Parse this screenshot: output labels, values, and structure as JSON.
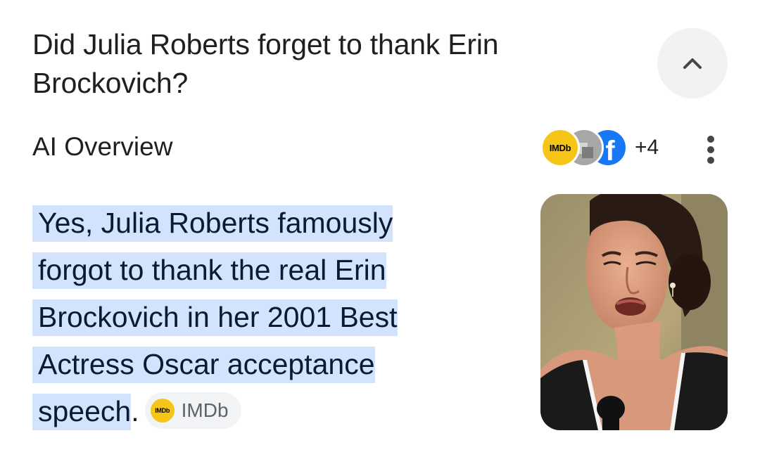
{
  "question": {
    "text": "Did Julia Roberts forget to thank Erin Brockovich?"
  },
  "collapse_icon": "chevron-up-icon",
  "overview": {
    "label": "AI Overview",
    "sources": {
      "avatars": [
        "imdb-logo",
        "grey-source-logo",
        "facebook-logo"
      ],
      "imdb_avatar_text": "IMDb",
      "facebook_avatar_text": "f",
      "more_count": "+4"
    },
    "menu_icon": "more-vert-icon"
  },
  "answer": {
    "text": "Yes, Julia Roberts famously forgot to thank the real Erin Brockovich in her 2001 Best Actress Oscar acceptance speech",
    "end_punct": ".",
    "source_chip": {
      "logo_text": "IMDb",
      "label": "IMDb"
    }
  },
  "image": {
    "subject": "photo of woman with dark hair speaking at microphone"
  },
  "colors": {
    "highlight": "#d3e3fd",
    "imdb_yellow": "#f5c518",
    "facebook_blue": "#1877f2",
    "chip_bg": "#f1f3f4",
    "button_bg": "#f0f2f4"
  }
}
